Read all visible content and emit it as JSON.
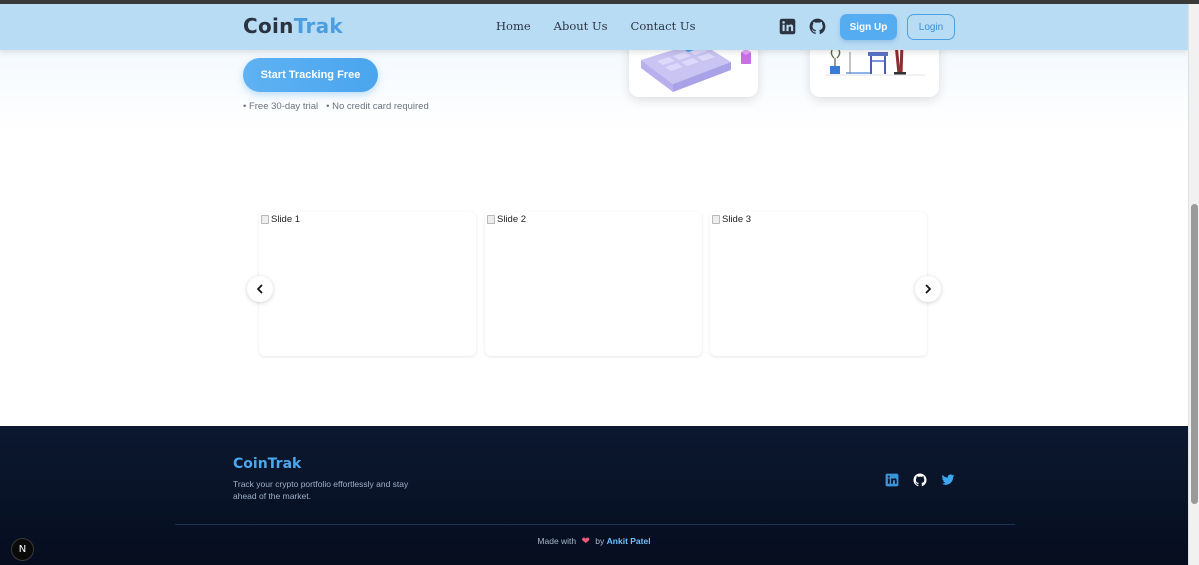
{
  "nav": {
    "logo_part1": "Coin",
    "logo_part2": "Trak",
    "links": [
      "Home",
      "About Us",
      "Contact Us"
    ],
    "signup_label": "Sign Up",
    "login_label": "Login"
  },
  "hero": {
    "cta_label": "Start Tracking Free",
    "perks": [
      "• Free 30-day trial",
      "• No credit card required"
    ]
  },
  "carousel": {
    "slides": [
      "Slide 1",
      "Slide 2",
      "Slide 3"
    ]
  },
  "footer": {
    "logo": "CoinTrak",
    "tagline": "Track your crypto portfolio effortlessly and stay ahead of the market.",
    "credit_prefix": "Made with",
    "credit_by": "by",
    "author": "Ankit Patel"
  },
  "badge": {
    "letter": "N"
  },
  "colors": {
    "accent": "#4b9fe0",
    "nav_bg": "#b9dcf5",
    "footer_bg": "#081226",
    "heart": "#f25a7a"
  },
  "icons": [
    "linkedin-icon",
    "github-icon",
    "twitter-icon",
    "chevron-left-icon",
    "chevron-right-icon",
    "heart-icon"
  ]
}
